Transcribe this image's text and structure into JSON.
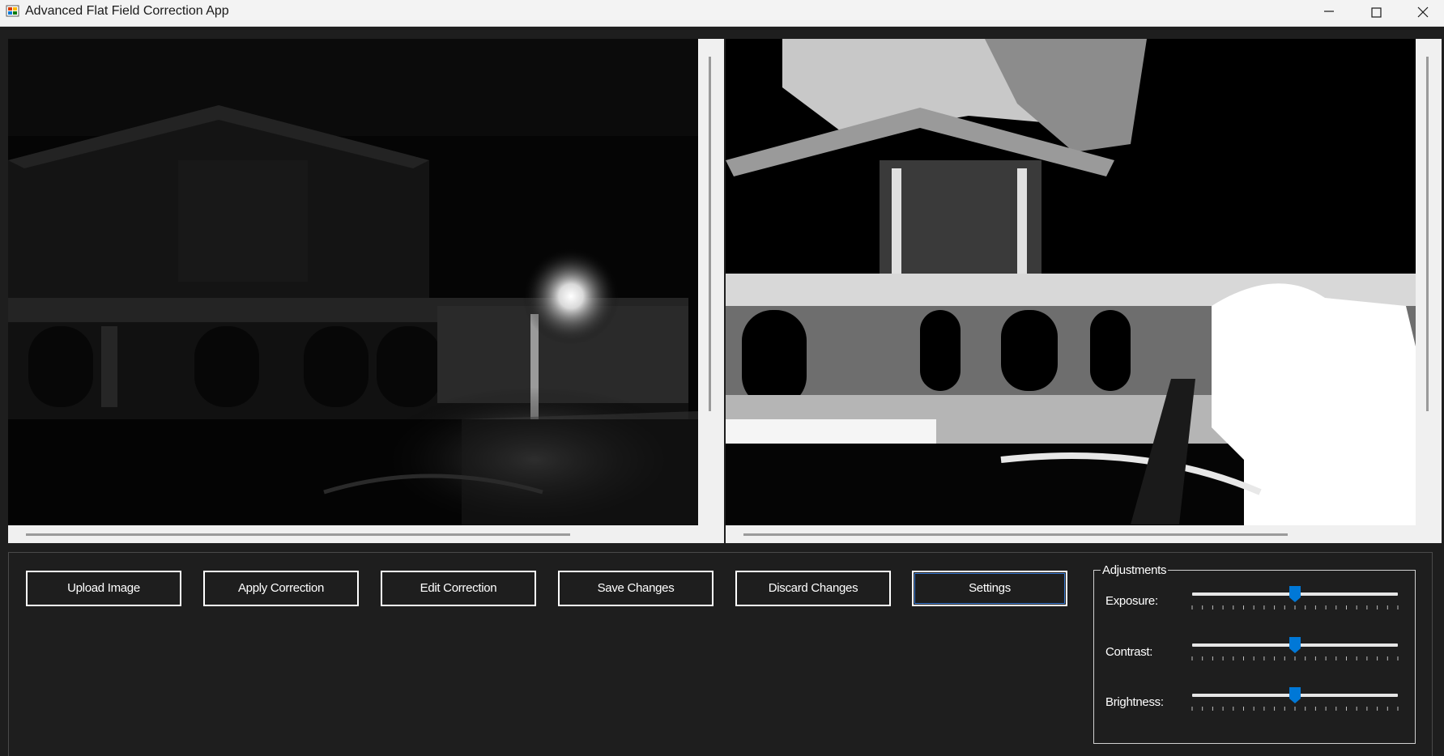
{
  "window": {
    "title": "Advanced Flat Field Correction App",
    "controls": {
      "minimize_icon": "minimize-icon",
      "maximize_icon": "maximize-icon",
      "close_icon": "close-icon"
    }
  },
  "image_panels": {
    "original": {
      "content": "night-scene-original"
    },
    "corrected": {
      "content": "night-scene-corrected"
    }
  },
  "toolbar": {
    "upload_label": "Upload Image",
    "apply_label": "Apply Correction",
    "edit_label": "Edit Correction",
    "save_label": "Save Changes",
    "discard_label": "Discard Changes",
    "settings_label": "Settings"
  },
  "adjustments": {
    "title": "Adjustments",
    "exposure": {
      "label": "Exposure:",
      "value_fraction": 0.5
    },
    "contrast": {
      "label": "Contrast:",
      "value_fraction": 0.5
    },
    "brightness": {
      "label": "Brightness:",
      "value_fraction": 0.5
    }
  },
  "colors": {
    "background": "#1e1e1e",
    "titlebar": "#f3f3f3",
    "slider_thumb": "#0078d7",
    "button_border": "#ffffff",
    "focus_outline": "#3a7bd5"
  }
}
